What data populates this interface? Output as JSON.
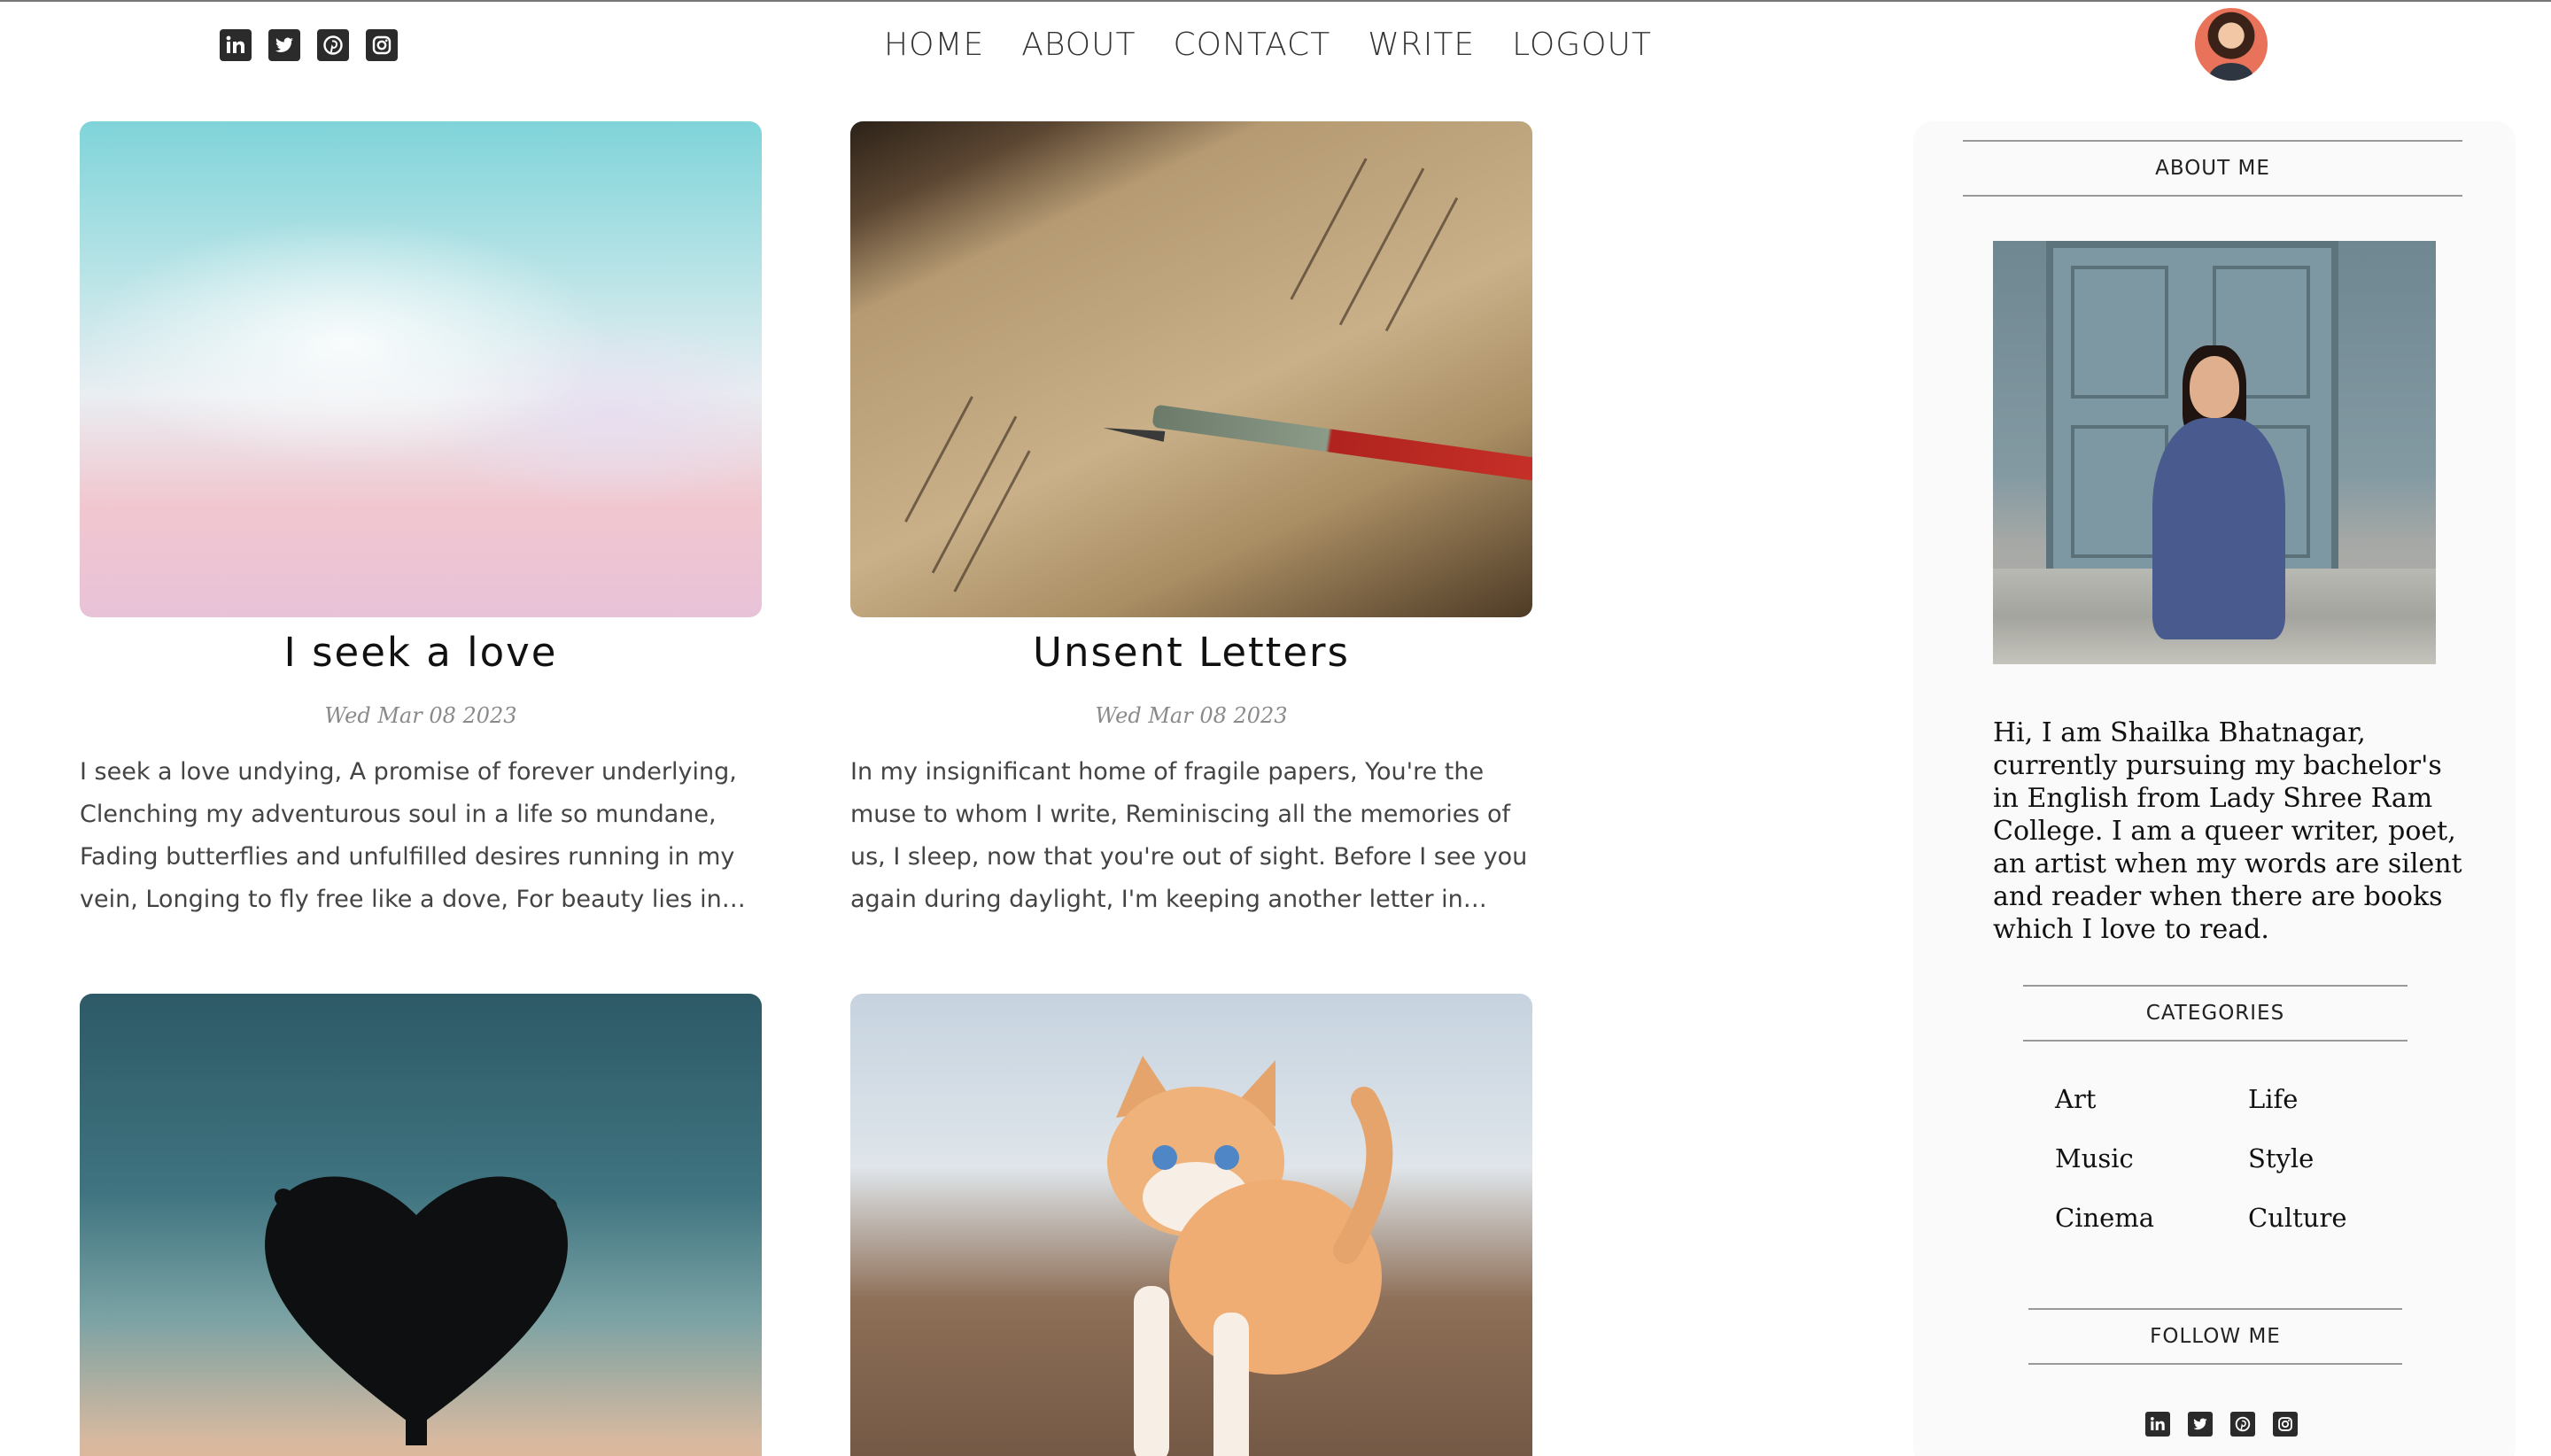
{
  "nav": {
    "items": [
      "HOME",
      "ABOUT",
      "CONTACT",
      "WRITE",
      "LOGOUT"
    ]
  },
  "social": {
    "icons": [
      "linkedin-icon",
      "twitter-icon",
      "pinterest-icon",
      "instagram-icon"
    ]
  },
  "posts": [
    {
      "title": "I seek a love",
      "date": "Wed Mar 08 2023",
      "desc": "I seek a love undying, A promise of forever underlying, Clenching my adventurous soul in a life so mundane, Fading butterflies and unfulfilled desires running in my vein, Longing to fly free like a dove, For beauty lies in…"
    },
    {
      "title": "Unsent Letters",
      "date": "Wed Mar 08 2023",
      "desc": "In my insignificant home of fragile papers, You're the muse to whom I write, Reminiscing all the memories of us, I sleep, now that you're out of sight. Before I see you again during daylight, I'm keeping another letter in your…"
    }
  ],
  "sidebar": {
    "about_heading": "ABOUT ME",
    "about_text": "Hi, I am Shailka Bhatnagar, currently pursuing my bachelor's in English from Lady Shree Ram College. I am a queer writer, poet, an artist when my words are silent and reader when there are books which I love to read.",
    "categories_heading": "CATEGORIES",
    "categories": [
      "Art",
      "Life",
      "Music",
      "Style",
      "Cinema",
      "Culture"
    ],
    "follow_heading": "FOLLOW ME"
  }
}
